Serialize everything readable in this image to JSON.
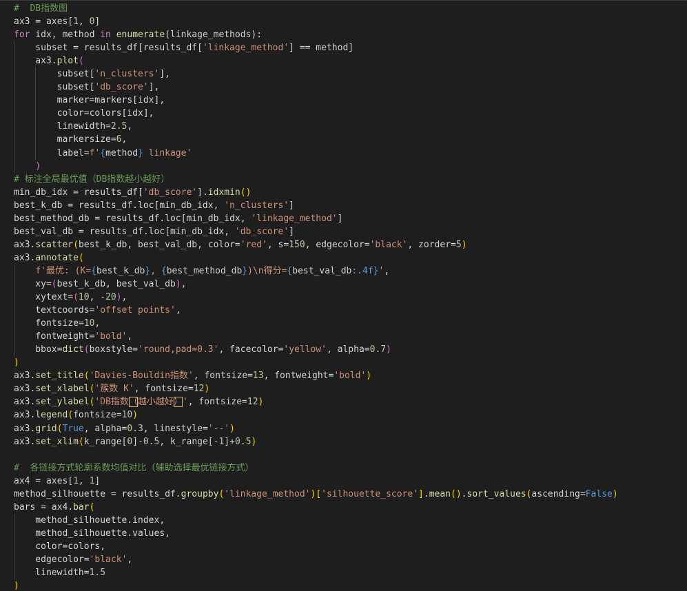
{
  "editor": {
    "guide_color": "#404040",
    "lines": [
      {
        "guides": [],
        "tokens": [
          {
            "t": "#  DB指数图",
            "c": "comment"
          }
        ]
      },
      {
        "guides": [],
        "tokens": [
          {
            "t": "ax3 = axes[",
            "c": "default"
          },
          {
            "t": "1",
            "c": "num"
          },
          {
            "t": ", ",
            "c": "default"
          },
          {
            "t": "0",
            "c": "num"
          },
          {
            "t": "]",
            "c": "default"
          }
        ]
      },
      {
        "guides": [],
        "tokens": [
          {
            "t": "for",
            "c": "keyword"
          },
          {
            "t": " idx, method ",
            "c": "default"
          },
          {
            "t": "in",
            "c": "keyword"
          },
          {
            "t": " ",
            "c": "default"
          },
          {
            "t": "enumerate",
            "c": "func"
          },
          {
            "t": "(linkage_methods):",
            "c": "default"
          }
        ]
      },
      {
        "guides": [
          0
        ],
        "tokens": [
          {
            "t": "    subset = results_df[results_df[",
            "c": "default"
          },
          {
            "t": "'linkage_method'",
            "c": "str"
          },
          {
            "t": "] == method]",
            "c": "default"
          }
        ]
      },
      {
        "guides": [
          0
        ],
        "tokens": [
          {
            "t": "    ax3.",
            "c": "default"
          },
          {
            "t": "plot",
            "c": "func"
          },
          {
            "t": "(",
            "c": "b2"
          }
        ]
      },
      {
        "guides": [
          0,
          4
        ],
        "tokens": [
          {
            "t": "        subset[",
            "c": "default"
          },
          {
            "t": "'n_clusters'",
            "c": "str"
          },
          {
            "t": "],",
            "c": "default"
          }
        ]
      },
      {
        "guides": [
          0,
          4
        ],
        "tokens": [
          {
            "t": "        subset[",
            "c": "default"
          },
          {
            "t": "'db_score'",
            "c": "str"
          },
          {
            "t": "],",
            "c": "default"
          }
        ]
      },
      {
        "guides": [
          0,
          4
        ],
        "tokens": [
          {
            "t": "        marker=markers[idx],",
            "c": "default"
          }
        ]
      },
      {
        "guides": [
          0,
          4
        ],
        "tokens": [
          {
            "t": "        color=colors[idx],",
            "c": "default"
          }
        ]
      },
      {
        "guides": [
          0,
          4
        ],
        "tokens": [
          {
            "t": "        linewidth=",
            "c": "default"
          },
          {
            "t": "2.5",
            "c": "num"
          },
          {
            "t": ",",
            "c": "default"
          }
        ]
      },
      {
        "guides": [
          0,
          4
        ],
        "tokens": [
          {
            "t": "        markersize=",
            "c": "default"
          },
          {
            "t": "6",
            "c": "num"
          },
          {
            "t": ",",
            "c": "default"
          }
        ]
      },
      {
        "guides": [
          0,
          4
        ],
        "tokens": [
          {
            "t": "        label=",
            "c": "default"
          },
          {
            "t": "f'",
            "c": "str"
          },
          {
            "t": "{",
            "c": "fmt"
          },
          {
            "t": "method",
            "c": "default"
          },
          {
            "t": "}",
            "c": "fmt"
          },
          {
            "t": " linkage'",
            "c": "str"
          }
        ]
      },
      {
        "guides": [
          0
        ],
        "tokens": [
          {
            "t": "    ",
            "c": "default"
          },
          {
            "t": ")",
            "c": "b2"
          }
        ]
      },
      {
        "guides": [],
        "tokens": [
          {
            "t": "# 标注全局最优值（DB指数越小越好）",
            "c": "comment"
          }
        ]
      },
      {
        "guides": [],
        "tokens": [
          {
            "t": "min_db_idx = results_df[",
            "c": "default"
          },
          {
            "t": "'db_score'",
            "c": "str"
          },
          {
            "t": "].",
            "c": "default"
          },
          {
            "t": "idxmin",
            "c": "func"
          },
          {
            "t": "()",
            "c": "b1"
          }
        ]
      },
      {
        "guides": [],
        "tokens": [
          {
            "t": "best_k_db = results_df.loc[min_db_idx, ",
            "c": "default"
          },
          {
            "t": "'n_clusters'",
            "c": "str"
          },
          {
            "t": "]",
            "c": "default"
          }
        ]
      },
      {
        "guides": [],
        "tokens": [
          {
            "t": "best_method_db = results_df.loc[min_db_idx, ",
            "c": "default"
          },
          {
            "t": "'linkage_method'",
            "c": "str"
          },
          {
            "t": "]",
            "c": "default"
          }
        ]
      },
      {
        "guides": [],
        "tokens": [
          {
            "t": "best_val_db = results_df.loc[min_db_idx, ",
            "c": "default"
          },
          {
            "t": "'db_score'",
            "c": "str"
          },
          {
            "t": "]",
            "c": "default"
          }
        ]
      },
      {
        "guides": [],
        "tokens": [
          {
            "t": "ax3.",
            "c": "default"
          },
          {
            "t": "scatter",
            "c": "func"
          },
          {
            "t": "(",
            "c": "b1"
          },
          {
            "t": "best_k_db, best_val_db, color=",
            "c": "default"
          },
          {
            "t": "'red'",
            "c": "str"
          },
          {
            "t": ", s=",
            "c": "default"
          },
          {
            "t": "150",
            "c": "num"
          },
          {
            "t": ", edgecolor=",
            "c": "default"
          },
          {
            "t": "'black'",
            "c": "str"
          },
          {
            "t": ", zorder=",
            "c": "default"
          },
          {
            "t": "5",
            "c": "num"
          },
          {
            "t": ")",
            "c": "b1"
          }
        ]
      },
      {
        "guides": [],
        "tokens": [
          {
            "t": "ax3.",
            "c": "default"
          },
          {
            "t": "annotate",
            "c": "func"
          },
          {
            "t": "(",
            "c": "b1"
          }
        ]
      },
      {
        "guides": [
          0
        ],
        "tokens": [
          {
            "t": "    ",
            "c": "default"
          },
          {
            "t": "f'最优: (K=",
            "c": "str"
          },
          {
            "t": "{",
            "c": "fmt"
          },
          {
            "t": "best_k_db",
            "c": "default"
          },
          {
            "t": "}",
            "c": "fmt"
          },
          {
            "t": ", ",
            "c": "str"
          },
          {
            "t": "{",
            "c": "fmt"
          },
          {
            "t": "best_method_db",
            "c": "default"
          },
          {
            "t": "}",
            "c": "fmt"
          },
          {
            "t": ")\\n得分=",
            "c": "str"
          },
          {
            "t": "{",
            "c": "fmt"
          },
          {
            "t": "best_val_db",
            "c": "default"
          },
          {
            "t": ":.4f",
            "c": "fmt"
          },
          {
            "t": "}",
            "c": "fmt"
          },
          {
            "t": "'",
            "c": "str"
          },
          {
            "t": ",",
            "c": "default"
          }
        ]
      },
      {
        "guides": [
          0
        ],
        "tokens": [
          {
            "t": "    xy=",
            "c": "default"
          },
          {
            "t": "(",
            "c": "b2"
          },
          {
            "t": "best_k_db, best_val_db",
            "c": "default"
          },
          {
            "t": ")",
            "c": "b2"
          },
          {
            "t": ",",
            "c": "default"
          }
        ]
      },
      {
        "guides": [
          0
        ],
        "tokens": [
          {
            "t": "    xytext=",
            "c": "default"
          },
          {
            "t": "(",
            "c": "b2"
          },
          {
            "t": "10",
            "c": "num"
          },
          {
            "t": ", ",
            "c": "default"
          },
          {
            "t": "-20",
            "c": "num"
          },
          {
            "t": ")",
            "c": "b2"
          },
          {
            "t": ",",
            "c": "default"
          }
        ]
      },
      {
        "guides": [
          0
        ],
        "tokens": [
          {
            "t": "    textcoords=",
            "c": "default"
          },
          {
            "t": "'offset points'",
            "c": "str"
          },
          {
            "t": ",",
            "c": "default"
          }
        ]
      },
      {
        "guides": [
          0
        ],
        "tokens": [
          {
            "t": "    fontsize=",
            "c": "default"
          },
          {
            "t": "10",
            "c": "num"
          },
          {
            "t": ",",
            "c": "default"
          }
        ]
      },
      {
        "guides": [
          0
        ],
        "tokens": [
          {
            "t": "    fontweight=",
            "c": "default"
          },
          {
            "t": "'bold'",
            "c": "str"
          },
          {
            "t": ",",
            "c": "default"
          }
        ]
      },
      {
        "guides": [
          0
        ],
        "tokens": [
          {
            "t": "    bbox=",
            "c": "default"
          },
          {
            "t": "dict",
            "c": "func"
          },
          {
            "t": "(",
            "c": "b2"
          },
          {
            "t": "boxstyle=",
            "c": "default"
          },
          {
            "t": "'round,pad=0.3'",
            "c": "str"
          },
          {
            "t": ", facecolor=",
            "c": "default"
          },
          {
            "t": "'yellow'",
            "c": "str"
          },
          {
            "t": ", alpha=",
            "c": "default"
          },
          {
            "t": "0.7",
            "c": "num"
          },
          {
            "t": ")",
            "c": "b2"
          }
        ]
      },
      {
        "guides": [],
        "tokens": [
          {
            "t": ")",
            "c": "b1"
          }
        ]
      },
      {
        "guides": [],
        "tokens": [
          {
            "t": "ax3.",
            "c": "default"
          },
          {
            "t": "set_title",
            "c": "func"
          },
          {
            "t": "(",
            "c": "b1"
          },
          {
            "t": "'Davies-Bouldin指数'",
            "c": "str"
          },
          {
            "t": ", fontsize=",
            "c": "default"
          },
          {
            "t": "13",
            "c": "num"
          },
          {
            "t": ", fontweight=",
            "c": "default"
          },
          {
            "t": "'bold'",
            "c": "str"
          },
          {
            "t": ")",
            "c": "b1"
          }
        ]
      },
      {
        "guides": [],
        "tokens": [
          {
            "t": "ax3.",
            "c": "default"
          },
          {
            "t": "set_xlabel",
            "c": "func"
          },
          {
            "t": "(",
            "c": "b1"
          },
          {
            "t": "'簇数 K'",
            "c": "str"
          },
          {
            "t": ", fontsize=",
            "c": "default"
          },
          {
            "t": "12",
            "c": "num"
          },
          {
            "t": ")",
            "c": "b1"
          }
        ]
      },
      {
        "guides": [],
        "tokens": [
          {
            "t": "ax3.",
            "c": "default"
          },
          {
            "t": "set_ylabel",
            "c": "func"
          },
          {
            "t": "(",
            "c": "b1"
          },
          {
            "t": "'DB指数",
            "c": "str"
          },
          {
            "t": "（",
            "c": "warn"
          },
          {
            "t": "越小越好",
            "c": "str"
          },
          {
            "t": "）",
            "c": "warn"
          },
          {
            "t": "'",
            "c": "str"
          },
          {
            "t": ", fontsize=",
            "c": "default"
          },
          {
            "t": "12",
            "c": "num"
          },
          {
            "t": ")",
            "c": "b1"
          }
        ]
      },
      {
        "guides": [],
        "tokens": [
          {
            "t": "ax3.",
            "c": "default"
          },
          {
            "t": "legend",
            "c": "func"
          },
          {
            "t": "(",
            "c": "b1"
          },
          {
            "t": "fontsize=",
            "c": "default"
          },
          {
            "t": "10",
            "c": "num"
          },
          {
            "t": ")",
            "c": "b1"
          }
        ]
      },
      {
        "guides": [],
        "tokens": [
          {
            "t": "ax3.",
            "c": "default"
          },
          {
            "t": "grid",
            "c": "func"
          },
          {
            "t": "(",
            "c": "b1"
          },
          {
            "t": "True",
            "c": "const"
          },
          {
            "t": ", alpha=",
            "c": "default"
          },
          {
            "t": "0.3",
            "c": "num"
          },
          {
            "t": ", linestyle=",
            "c": "default"
          },
          {
            "t": "'--'",
            "c": "str"
          },
          {
            "t": ")",
            "c": "b1"
          }
        ]
      },
      {
        "guides": [],
        "tokens": [
          {
            "t": "ax3.",
            "c": "default"
          },
          {
            "t": "set_xlim",
            "c": "func"
          },
          {
            "t": "(",
            "c": "b1"
          },
          {
            "t": "k_range[",
            "c": "default"
          },
          {
            "t": "0",
            "c": "num"
          },
          {
            "t": "]-",
            "c": "default"
          },
          {
            "t": "0.5",
            "c": "num"
          },
          {
            "t": ", k_range[",
            "c": "default"
          },
          {
            "t": "-1",
            "c": "num"
          },
          {
            "t": "]+",
            "c": "default"
          },
          {
            "t": "0.5",
            "c": "num"
          },
          {
            "t": ")",
            "c": "b1"
          }
        ]
      },
      {
        "guides": [],
        "tokens": []
      },
      {
        "guides": [],
        "tokens": [
          {
            "t": "#  各链接方式轮廓系数均值对比（辅助选择最优链接方式）",
            "c": "comment"
          }
        ]
      },
      {
        "guides": [],
        "tokens": [
          {
            "t": "ax4 = axes[",
            "c": "default"
          },
          {
            "t": "1",
            "c": "num"
          },
          {
            "t": ", ",
            "c": "default"
          },
          {
            "t": "1",
            "c": "num"
          },
          {
            "t": "]",
            "c": "default"
          }
        ]
      },
      {
        "guides": [],
        "tokens": [
          {
            "t": "method_silhouette = results_df.",
            "c": "default"
          },
          {
            "t": "groupby",
            "c": "func"
          },
          {
            "t": "(",
            "c": "b1"
          },
          {
            "t": "'linkage_method'",
            "c": "str"
          },
          {
            "t": ")",
            "c": "b1"
          },
          {
            "t": "[",
            "c": "b1"
          },
          {
            "t": "'silhouette_score'",
            "c": "str"
          },
          {
            "t": "]",
            "c": "b1"
          },
          {
            "t": ".",
            "c": "default"
          },
          {
            "t": "mean",
            "c": "func"
          },
          {
            "t": "()",
            "c": "b1"
          },
          {
            "t": ".",
            "c": "default"
          },
          {
            "t": "sort_values",
            "c": "func"
          },
          {
            "t": "(",
            "c": "b1"
          },
          {
            "t": "ascending=",
            "c": "default"
          },
          {
            "t": "False",
            "c": "const"
          },
          {
            "t": ")",
            "c": "b1"
          }
        ]
      },
      {
        "guides": [],
        "tokens": [
          {
            "t": "bars = ax4.",
            "c": "default"
          },
          {
            "t": "bar",
            "c": "func"
          },
          {
            "t": "(",
            "c": "b1"
          }
        ]
      },
      {
        "guides": [
          0
        ],
        "tokens": [
          {
            "t": "    method_silhouette.index,",
            "c": "default"
          }
        ]
      },
      {
        "guides": [
          0
        ],
        "tokens": [
          {
            "t": "    method_silhouette.values,",
            "c": "default"
          }
        ]
      },
      {
        "guides": [
          0
        ],
        "tokens": [
          {
            "t": "    color=colors,",
            "c": "default"
          }
        ]
      },
      {
        "guides": [
          0
        ],
        "tokens": [
          {
            "t": "    edgecolor=",
            "c": "default"
          },
          {
            "t": "'black'",
            "c": "str"
          },
          {
            "t": ",",
            "c": "default"
          }
        ]
      },
      {
        "guides": [
          0
        ],
        "tokens": [
          {
            "t": "    linewidth=",
            "c": "default"
          },
          {
            "t": "1.5",
            "c": "num"
          }
        ]
      },
      {
        "guides": [],
        "tokens": [
          {
            "t": ")",
            "c": "b1"
          }
        ]
      }
    ]
  }
}
